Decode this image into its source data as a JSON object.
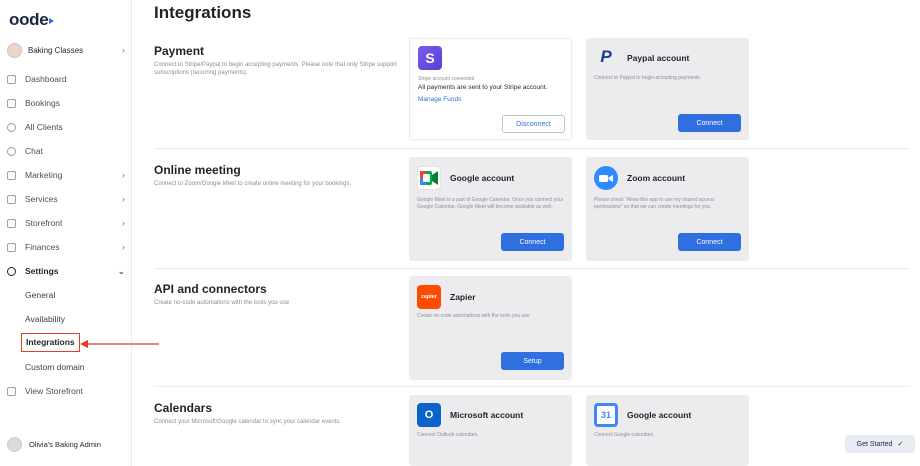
{
  "sidebar": {
    "logo": "oode",
    "business": "Baking Classes",
    "nav": [
      {
        "label": "Dashboard"
      },
      {
        "label": "Bookings"
      },
      {
        "label": "All Clients"
      },
      {
        "label": "Chat"
      },
      {
        "label": "Marketing",
        "chevron": "›"
      },
      {
        "label": "Services",
        "chevron": "›"
      },
      {
        "label": "Storefront",
        "chevron": "›"
      },
      {
        "label": "Finances",
        "chevron": "›"
      },
      {
        "label": "Settings",
        "chevron": "⌄"
      }
    ],
    "settings_sub": [
      "General",
      "Availability",
      "Integrations",
      "Custom domain"
    ],
    "view_storefront": "View Storefront",
    "user": "Olivia's Baking Admin",
    "annotation_color": "#e0402a"
  },
  "main": {
    "title": "Integrations",
    "sections": [
      {
        "title": "Payment",
        "desc": "Connect to Stripe/Paypal to begin accepting payments. Please note that only Stripe support subscriptions (recurring payments)."
      },
      {
        "title": "Online meeting",
        "desc": "Connect to Zoom/Google Meet to create online meeting for your bookings."
      },
      {
        "title": "API and connectors",
        "desc": "Create no-code automations with the tools you use"
      },
      {
        "title": "Calendars",
        "desc": "Connect your Microsoft/Google calendar to sync your calendar events."
      }
    ],
    "cards": {
      "stripe": {
        "status": "Stripe account connected",
        "message": "All payments are sent to your Stripe account.",
        "link": "Manage Funds",
        "button": "Disconnect",
        "logo_letter": "S"
      },
      "paypal": {
        "title": "Paypal account",
        "desc": "Connect to Paypal to begin accepting payments",
        "button": "Connect"
      },
      "google_meet": {
        "title": "Google account",
        "desc": "Google Meet is a part of Google Calendar. Once you connect your Google Calendar, Google Meet will become available as well.",
        "button": "Connect"
      },
      "zoom": {
        "title": "Zoom account",
        "desc": "Please check \"Allow this app to use my shared access permissions\" so that we can create meetings for you.",
        "button": "Connect"
      },
      "zapier": {
        "title": "Zapier",
        "desc": "Create no-code automations with the tools you use",
        "button": "Setup",
        "logo_text": "zapier"
      },
      "microsoft": {
        "title": "Microsoft account",
        "desc": "Connect Outlook calendars"
      },
      "google_cal": {
        "title": "Google account",
        "desc": "Connect Google calendars",
        "logo_text": "31"
      }
    },
    "get_started": "Get Started",
    "accent": "#2f6fdf"
  }
}
